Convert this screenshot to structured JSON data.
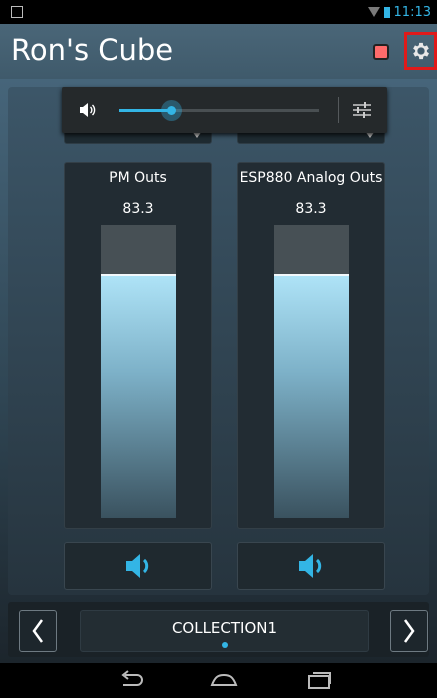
{
  "status_bar": {
    "time": "11:13"
  },
  "app_bar": {
    "title": "Ron's Cube"
  },
  "volume_popup": {
    "level_percent": 26
  },
  "channels": [
    {
      "name": "PM Outs",
      "value": "83.3",
      "level": 0.833
    },
    {
      "name": "ESP880 Analog Outs",
      "value": "83.3",
      "level": 0.833
    }
  ],
  "collection": {
    "label": "COLLECTION1"
  },
  "colors": {
    "accent": "#33b5e5",
    "highlight_border": "#e01a1a",
    "stop": "#ff6b6b"
  },
  "icons": {
    "status_left": "image-icon",
    "wifi": "wifi-icon",
    "battery": "battery-icon",
    "stop": "stop-icon",
    "settings": "gear-icon",
    "volume": "speaker-icon",
    "equalizer": "equalizer-icon",
    "mute": "speaker-icon",
    "prev": "chevron-left-icon",
    "next": "chevron-right-icon",
    "back": "back-icon",
    "home": "home-icon",
    "recents": "recents-icon"
  }
}
